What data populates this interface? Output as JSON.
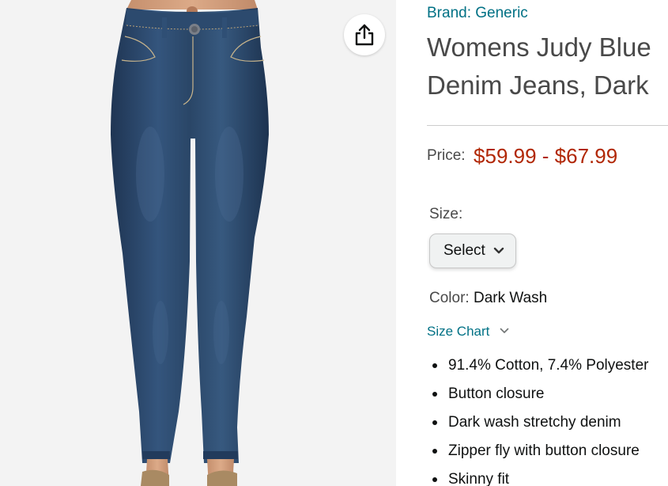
{
  "product": {
    "brand": "Brand: Generic",
    "title_line1": "Womens Judy Blue",
    "title_line2": "Denim Jeans, Dark",
    "image_alt": "High-waisted skinny dark wash denim jeans"
  },
  "price": {
    "label": "Price:",
    "range": "$59.99 - $67.99",
    "color": "#b12704"
  },
  "size": {
    "label": "Size:",
    "selected": "Select"
  },
  "color_option": {
    "label": "Color:",
    "value": "Dark Wash"
  },
  "size_chart": {
    "label": "Size Chart"
  },
  "features": [
    "91.4% Cotton, 7.4% Polyester",
    "Button closure",
    "Dark wash stretchy denim",
    "Zipper fly with button closure",
    "Skinny fit"
  ],
  "icons": {
    "share": "share-icon",
    "chevron": "chevron-down-icon"
  },
  "colors": {
    "link": "#007185",
    "price": "#b12704",
    "image_background": "#f3f3f3"
  }
}
